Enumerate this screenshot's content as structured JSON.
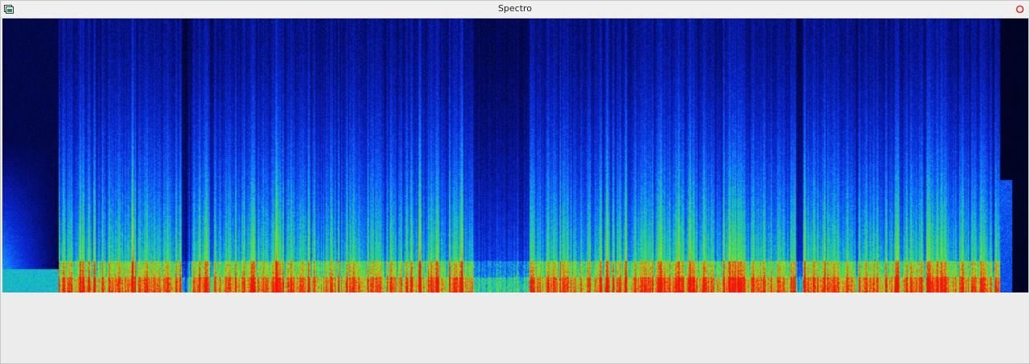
{
  "window": {
    "title": "Spectro"
  },
  "icons": {
    "app": "spectro-app-icon",
    "close": "close-circle-icon"
  },
  "colors": {
    "window_bg": "#ececec",
    "titlebar_bg": "#f0f0f0",
    "close_red": "#e0302a",
    "spectrogram_colormap": [
      "#000000",
      "#0a1aa8",
      "#1060ff",
      "#18c8c0",
      "#6de030",
      "#c8e010",
      "#ff3010"
    ]
  }
}
